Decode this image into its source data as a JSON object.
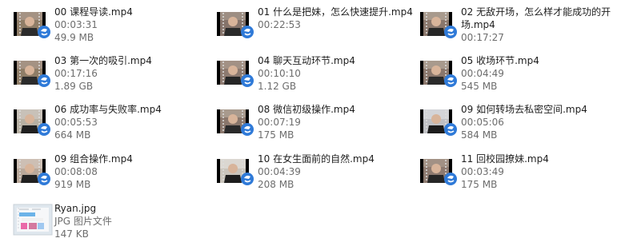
{
  "files": [
    {
      "name": "00 课程导读.mp4",
      "duration": "00:03:31",
      "size": "49.9 MB",
      "kind": "video"
    },
    {
      "name": "01 什么是把妹，怎么快速提升.mp4",
      "duration": "00:22:53",
      "size": "",
      "kind": "video"
    },
    {
      "name": "02 无敌开场，怎么样才能成功的开场.mp4",
      "duration": "00:17:27",
      "size": "",
      "kind": "video"
    },
    {
      "name": "03 第一次的吸引.mp4",
      "duration": "00:17:16",
      "size": "1.89 GB",
      "kind": "video"
    },
    {
      "name": "04 聊天互动环节.mp4",
      "duration": "00:10:10",
      "size": "1.12 GB",
      "kind": "video"
    },
    {
      "name": "05 收场环节.mp4",
      "duration": "00:04:49",
      "size": "545 MB",
      "kind": "video"
    },
    {
      "name": "06 成功率与失败率.mp4",
      "duration": "00:05:53",
      "size": "664 MB",
      "kind": "video"
    },
    {
      "name": "08 微信初级操作.mp4",
      "duration": "00:07:19",
      "size": "175 MB",
      "kind": "video"
    },
    {
      "name": "09 如何转场去私密空间.mp4",
      "duration": "00:05:06",
      "size": "584 MB",
      "kind": "video"
    },
    {
      "name": "09 组合操作.mp4",
      "duration": "00:08:08",
      "size": "919 MB",
      "kind": "video"
    },
    {
      "name": "10 在女生面前的自然.mp4",
      "duration": "00:04:39",
      "size": "208 MB",
      "kind": "video"
    },
    {
      "name": "11 回校园撩妹.mp4",
      "duration": "00:03:49",
      "size": "175 MB",
      "kind": "video"
    },
    {
      "name": "Ryan.jpg",
      "duration": "JPG 图片文件",
      "size": "147 KB",
      "kind": "image"
    }
  ],
  "icons": {
    "video": "video-file-thumbnail-icon",
    "image": "image-file-thumbnail-icon",
    "overlay": "media-player-overlay-icon"
  },
  "colors": {
    "filename": "#1e1e1e",
    "details": "#6d6d6d",
    "overlay_blue": "#2f7ad8"
  }
}
